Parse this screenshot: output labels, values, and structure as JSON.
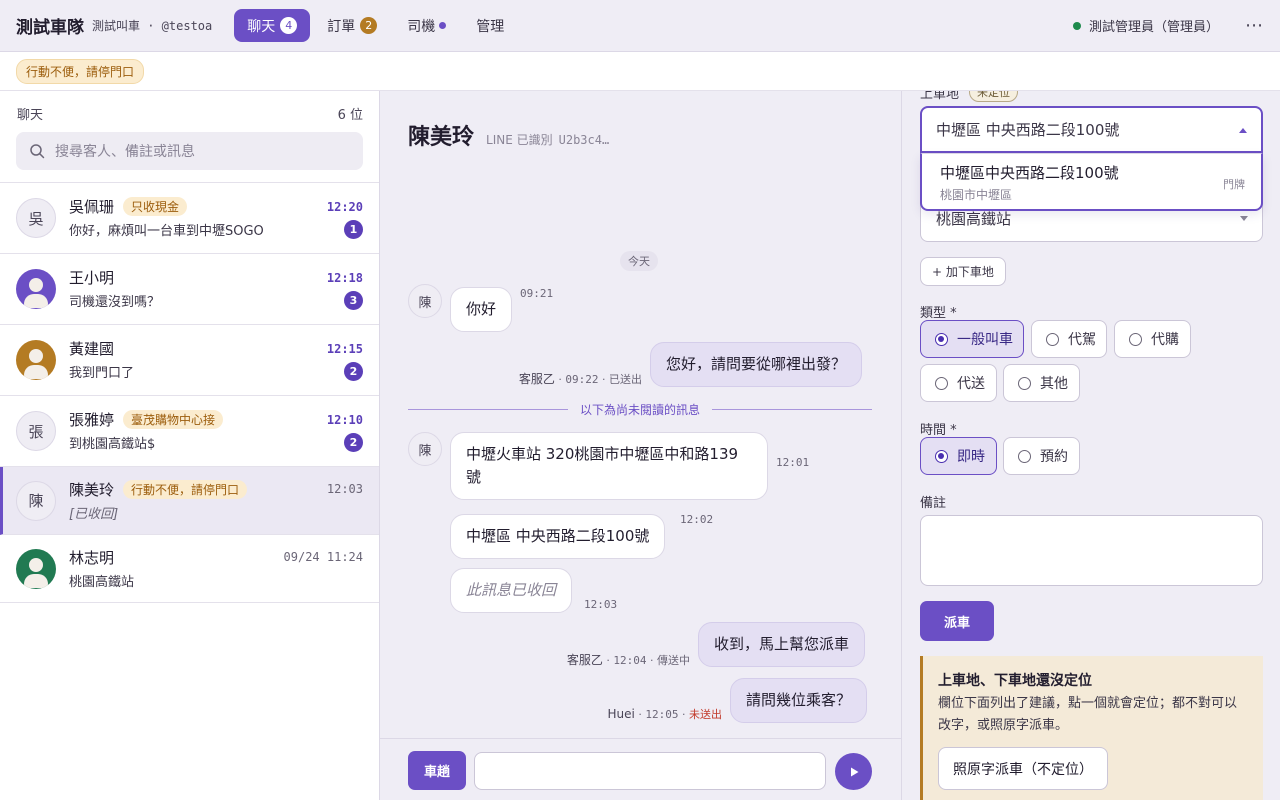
{
  "header": {
    "brand": "測試車隊",
    "subtitle": "測試叫車 · @testoa",
    "tabs": [
      {
        "label": "聊天",
        "badge": "4"
      },
      {
        "label": "訂單",
        "badge": "2"
      },
      {
        "label": "司機"
      },
      {
        "label": "管理"
      }
    ],
    "user": "測試管理員（管理員）",
    "more": "⋯"
  },
  "banner": {
    "tag": "行動不便，請停門口"
  },
  "sidebar": {
    "title": "聊天",
    "count": "6 位",
    "search_placeholder": "搜尋客人、備註或訊息",
    "conversations": [
      {
        "avatar": "吳",
        "name": "吳佩珊",
        "tag": "只收現金",
        "time": "12:20",
        "preview": "你好，麻煩叫一台車到中壢SOGO",
        "unread": "1"
      },
      {
        "avatar_color": "#6b4fc5",
        "name": "王小明",
        "time": "12:18",
        "preview": "司機還沒到嗎？",
        "unread": "3"
      },
      {
        "avatar_color": "#b47b23",
        "name": "黃建國",
        "time": "12:15",
        "preview": "我到門口了",
        "unread": "2"
      },
      {
        "avatar": "張",
        "name": "張雅婷",
        "tag": "臺茂購物中心接",
        "time": "12:10",
        "preview": "到桃園高鐵站$",
        "unread": "2"
      },
      {
        "avatar": "陳",
        "name": "陳美玲",
        "tag": "行動不便，請停門口",
        "time": "12:03",
        "preview": "[已收回]"
      },
      {
        "avatar_color": "#217a52",
        "name": "林志明",
        "time": "09/24 11:24",
        "preview": "桃園高鐵站"
      }
    ]
  },
  "chat": {
    "name": "陳美玲",
    "meta": "LINE 已識別",
    "uid": "U2b3c4…",
    "day": "今天",
    "avatar": "陳",
    "unread_divider": "以下為尚未閱讀的訊息",
    "messages": {
      "m1": {
        "text": "你好",
        "time": "09:21"
      },
      "m2": {
        "text": "您好，請問要從哪裡出發？",
        "who": "客服乙",
        "time": "09:22",
        "status": "已送出"
      },
      "m3": {
        "text": "中壢火車站 320桃園市中壢區中和路139號",
        "time": "12:01"
      },
      "m4": {
        "text": "中壢區 中央西路二段100號",
        "time": "12:02"
      },
      "m5": {
        "text": "此訊息已收回",
        "time": "12:03"
      },
      "m6": {
        "text": "收到，馬上幫您派車",
        "who": "客服乙",
        "time": "12:04",
        "status": "傳送中"
      },
      "m7": {
        "text": "請問幾位乘客？",
        "who": "Huei",
        "time": "12:05",
        "status": "未送出"
      }
    },
    "composer": {
      "quick_label": "車趟"
    }
  },
  "form": {
    "pickup_label": "上車地",
    "pickup_badge": "未定位",
    "pickup_value": "中壢區 中央西路二段100號",
    "suggestion": {
      "title": "中壢區中央西路二段100號",
      "sub": "桃園市中壢區",
      "kind": "門牌"
    },
    "dropoff_value": "桃園高鐵站",
    "add_dropoff": "+ 加下車地",
    "type_label": "類型 *",
    "types": [
      "一般叫車",
      "代駕",
      "代購",
      "代送",
      "其他"
    ],
    "time_label": "時間 *",
    "times": [
      "即時",
      "預約"
    ],
    "note_label": "備註",
    "dispatch": "派車",
    "warning": {
      "title": "上車地、下車地還沒定位",
      "body": "欄位下面列出了建議，點一個就會定位；都不對可以改字，或照原字派車。",
      "button": "照原字派車（不定位）"
    }
  }
}
